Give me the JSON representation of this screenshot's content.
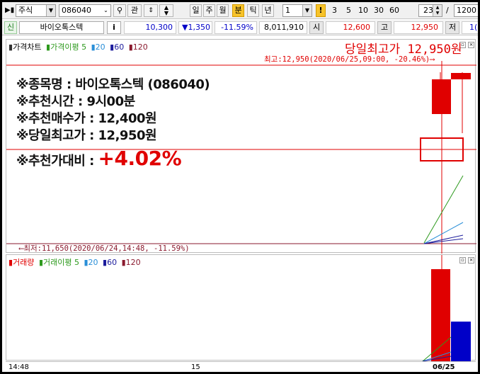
{
  "toolbar": {
    "market": "주식",
    "code": "086040",
    "lookup_label": "관",
    "periods": [
      "일",
      "주",
      "월",
      "분",
      "틱",
      "년"
    ],
    "active_period": "분",
    "interval_value": "1",
    "interval_badge": "!",
    "minute_options": [
      "3",
      "5",
      "10",
      "30",
      "60"
    ],
    "count_value": "23",
    "slash": "/",
    "total_value": "1200"
  },
  "quote": {
    "tag": "신",
    "stock_name": "바이오톡스텍",
    "info_label": "i",
    "price": "10,300",
    "change": "▼1,350",
    "change_rate": "-11.59%",
    "volume": "8,011,910",
    "open_label": "시",
    "open": "12,600",
    "high_label": "고",
    "high": "12,950",
    "low_label": "저",
    "low_partial": "1("
  },
  "price_panel": {
    "legend": [
      "가격차트",
      "가격이평 5",
      "20",
      "60",
      "120"
    ],
    "banner": "당일최고가 12,950원",
    "high_marker": "최고:12,950(2020/06/25,09:00, -20.46%)⟶",
    "low_marker": "⟵최저:11,650(2020/06/24,14:48, -11.59%)",
    "overlay_lines": [
      "※종목명 : 바이오톡스텍 (086040)",
      "※추천시간 : 9시00분",
      "※추천매수가 : 12,400원",
      "※당일최고가 : 12,950원"
    ],
    "overlay_label": "※추천가대비 : ",
    "overlay_value": "+4.02%"
  },
  "volume_panel": {
    "legend": [
      "거래량",
      "거래이평 5",
      "20",
      "60",
      "120"
    ]
  },
  "xaxis": {
    "labels": [
      "14:48",
      "15",
      "06/25"
    ]
  },
  "colors": {
    "up": "#e00000",
    "down": "#0000c8",
    "ma5": "#2e9a1e",
    "ma20": "#2a8fd8",
    "ma60": "#1c1c9c",
    "ma120": "#8a1a2e",
    "active_tab": "#f7c32a"
  }
}
